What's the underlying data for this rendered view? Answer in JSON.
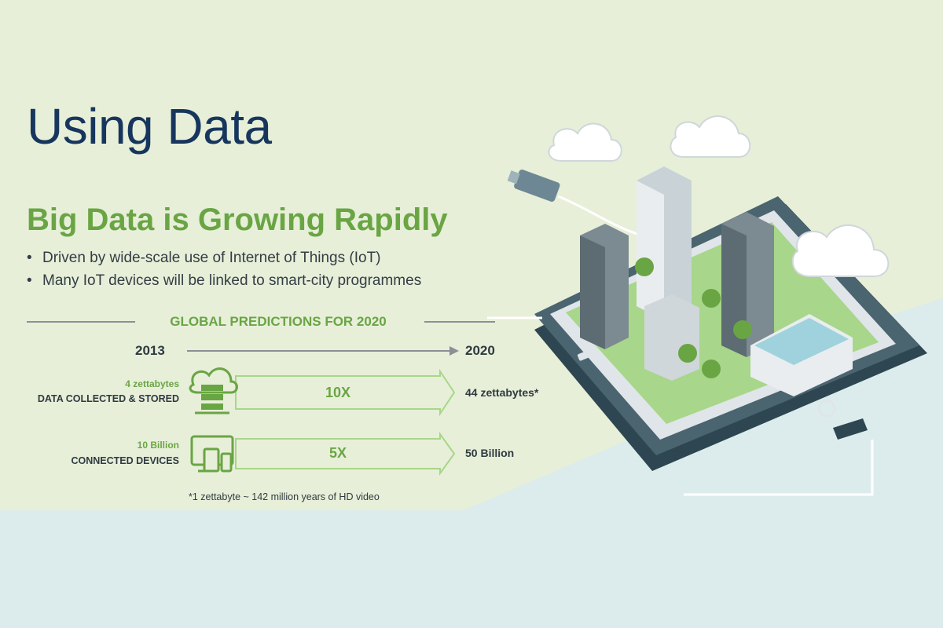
{
  "header": {
    "title": "Using Data"
  },
  "section": {
    "heading": "Big Data is Growing Rapidly",
    "bullets": [
      "Driven by wide-scale use of Internet of Things (IoT)",
      "Many IoT devices will be linked to smart-city programmes"
    ]
  },
  "predictions": {
    "title": "GLOBAL PREDICTIONS FOR 2020",
    "start_year": "2013",
    "end_year": "2020",
    "rows": [
      {
        "value_label": "4 zettabytes",
        "category": "DATA COLLECTED & STORED",
        "icon": "cloud-server-icon",
        "multiplier": "10X",
        "result": "44 zettabytes*"
      },
      {
        "value_label": "10 Billion",
        "category": "CONNECTED DEVICES",
        "icon": "devices-icon",
        "multiplier": "5X",
        "result": "50 Billion"
      }
    ],
    "footnote": "*1 zettabyte ~ 142 million years of HD video"
  },
  "colors": {
    "background": "#e7efd9",
    "background_lower": "#dcecec",
    "title": "#17365d",
    "accent_green": "#6aa544",
    "body_text": "#333d44"
  },
  "illustration": {
    "icons": [
      "smartphone-icon",
      "city-buildings-icon",
      "cloud-upload-icon",
      "usb-plug-icon"
    ]
  }
}
